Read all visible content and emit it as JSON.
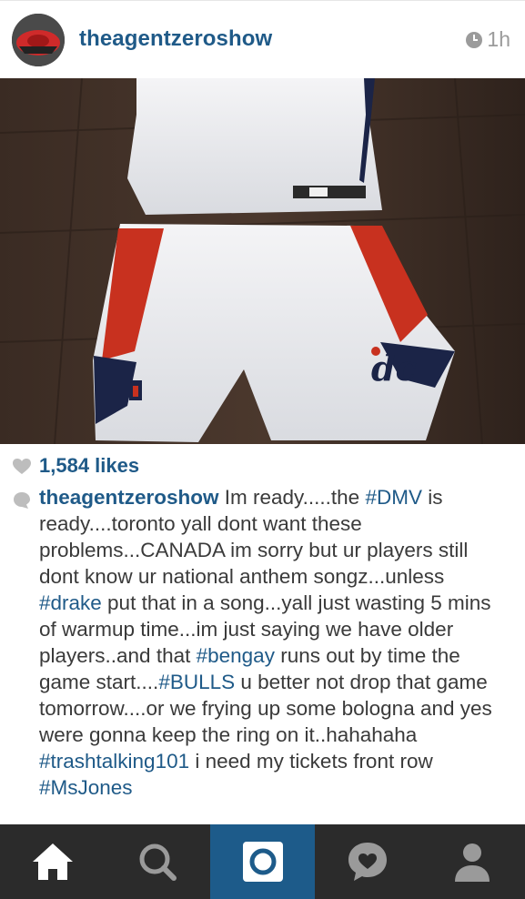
{
  "post": {
    "username": "theagentzeroshow",
    "time": "1h",
    "likes": "1,584 likes",
    "caption_segments": [
      {
        "type": "user",
        "text": "theagentzeroshow"
      },
      {
        "type": "text",
        "text": " Im ready.....the "
      },
      {
        "type": "tag",
        "text": "#DMV"
      },
      {
        "type": "text",
        "text": " is ready....toronto yall dont want these problems...CANADA  im sorry but ur players still dont know ur national anthem songz...unless "
      },
      {
        "type": "tag",
        "text": "#drake"
      },
      {
        "type": "text",
        "text": " put that in a song...yall just wasting 5 mins of warmup time...im just saying we have older players..and that "
      },
      {
        "type": "tag",
        "text": "#bengay"
      },
      {
        "type": "text",
        "text": " runs out by time the game start...."
      },
      {
        "type": "tag",
        "text": "#BULLS"
      },
      {
        "type": "text",
        "text": " u better not drop that game tomorrow....or we frying up some bologna and yes were gonna keep the ring on it..hahahaha "
      },
      {
        "type": "tag",
        "text": "#trashtalking101"
      },
      {
        "type": "text",
        "text": " i need my tickets front row "
      },
      {
        "type": "tag",
        "text": "#MsJones"
      }
    ]
  },
  "tabs": [
    {
      "name": "home",
      "icon": "home-icon"
    },
    {
      "name": "explore",
      "icon": "search-icon"
    },
    {
      "name": "camera",
      "icon": "camera-icon",
      "active": true
    },
    {
      "name": "activity",
      "icon": "heart-bubble-icon"
    },
    {
      "name": "profile",
      "icon": "person-icon"
    }
  ],
  "colors": {
    "link": "#1f5a88",
    "tabbar": "#2b2b2b",
    "tab_active": "#1d5b8a"
  }
}
